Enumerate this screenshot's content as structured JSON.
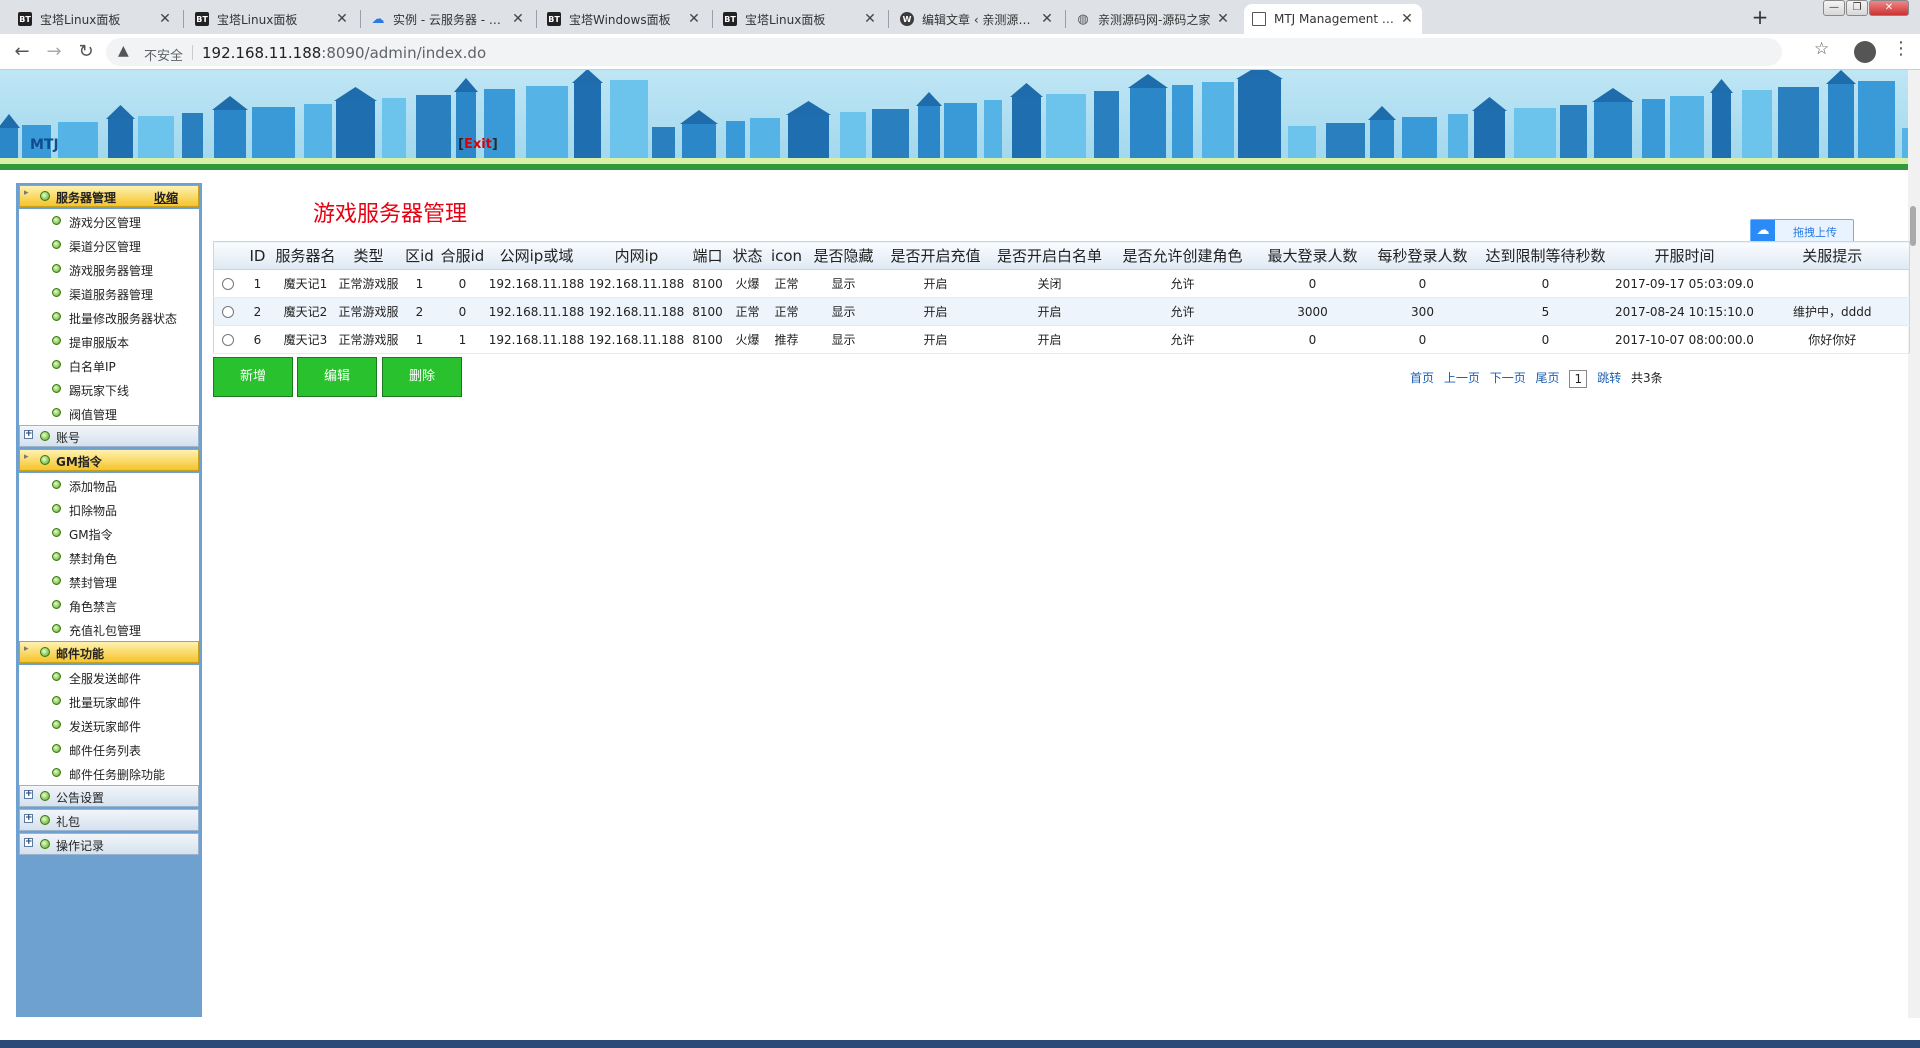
{
  "browser": {
    "tabs": [
      {
        "title": "宝塔Linux面板",
        "icon": "bt-icon"
      },
      {
        "title": "宝塔Linux面板",
        "icon": "bt-icon"
      },
      {
        "title": "实例 - 云服务器 - 控制台",
        "icon": "cloud-icon"
      },
      {
        "title": "宝塔Windows面板",
        "icon": "bt-icon"
      },
      {
        "title": "宝塔Linux面板",
        "icon": "bt-icon"
      },
      {
        "title": "编辑文章 ‹ 亲测源码网 — W",
        "icon": "wordpress-icon"
      },
      {
        "title": "亲测源码网-源码之家",
        "icon": "globe-icon"
      },
      {
        "title": "MTJ Management System",
        "icon": "page-icon",
        "active": true
      }
    ],
    "bt_glyph": "BT",
    "insecure_label": "不安全",
    "url_host": "192.168.11.188",
    "url_rest": ":8090/admin/index.do"
  },
  "header": {
    "brand": "MTJ",
    "exit_open": "[",
    "exit_label": "Exit",
    "exit_close": "]"
  },
  "sidebar": {
    "collapse_label": "收缩",
    "groups": [
      {
        "title": "服务器管理",
        "expanded": true,
        "items": [
          "游戏分区管理",
          "渠道分区管理",
          "游戏服务器管理",
          "渠道服务器管理",
          "批量修改服务器状态",
          "提审服版本",
          "白名单IP",
          "踢玩家下线",
          "阀值管理"
        ]
      },
      {
        "title": "账号",
        "expanded": false,
        "items": []
      },
      {
        "title": "GM指令",
        "expanded": true,
        "items": [
          "添加物品",
          "扣除物品",
          "GM指令",
          "禁封角色",
          "禁封管理",
          "角色禁言",
          "充值礼包管理"
        ]
      },
      {
        "title": "邮件功能",
        "expanded": true,
        "items": [
          "全服发送邮件",
          "批量玩家邮件",
          "发送玩家邮件",
          "邮件任务列表",
          "邮件任务删除功能"
        ]
      },
      {
        "title": "公告设置",
        "expanded": false,
        "items": []
      },
      {
        "title": "礼包",
        "expanded": false,
        "items": []
      },
      {
        "title": "操作记录",
        "expanded": false,
        "items": []
      }
    ]
  },
  "main": {
    "title": "游戏服务器管理",
    "upload_label": "拖拽上传",
    "columns": [
      "",
      "ID",
      "服务器名",
      "类型",
      "区id",
      "合服id",
      "公网ip或域",
      "内网ip",
      "端口",
      "状态",
      "icon",
      "是否隐藏",
      "是否开启充值",
      "是否开启白名单",
      "是否允许创建角色",
      "最大登录人数",
      "每秒登录人数",
      "达到限制等待秒数",
      "开服时间",
      "关服提示"
    ],
    "rows": [
      [
        "1",
        "魔天记1",
        "正常游戏服",
        "1",
        "0",
        "192.168.11.188",
        "192.168.11.188",
        "8100",
        "火爆",
        "正常",
        "显示",
        "开启",
        "关闭",
        "允许",
        "0",
        "0",
        "0",
        "2017-09-17 05:03:09.0",
        ""
      ],
      [
        "2",
        "魔天记2",
        "正常游戏服",
        "2",
        "0",
        "192.168.11.188",
        "192.168.11.188",
        "8100",
        "正常",
        "正常",
        "显示",
        "开启",
        "开启",
        "允许",
        "3000",
        "300",
        "5",
        "2017-08-24 10:15:10.0",
        "维护中，dddd"
      ],
      [
        "6",
        "魔天记3",
        "正常游戏服",
        "1",
        "1",
        "192.168.11.188",
        "192.168.11.188",
        "8100",
        "火爆",
        "推荐",
        "显示",
        "开启",
        "开启",
        "允许",
        "0",
        "0",
        "0",
        "2017-10-07 08:00:00.0",
        "你好你好"
      ]
    ],
    "buttons": {
      "add": "新增",
      "edit": "编辑",
      "delete": "删除"
    },
    "pager": {
      "first": "首页",
      "prev": "上一页",
      "next": "下一页",
      "last": "尾页",
      "page": "1",
      "go": "跳转",
      "total": "共3条"
    }
  },
  "colors": {
    "title_red": "#e60012",
    "button_green": "#29c22e",
    "sidebar_blue": "#6ea1cf",
    "active_header": "#f5c42c"
  }
}
